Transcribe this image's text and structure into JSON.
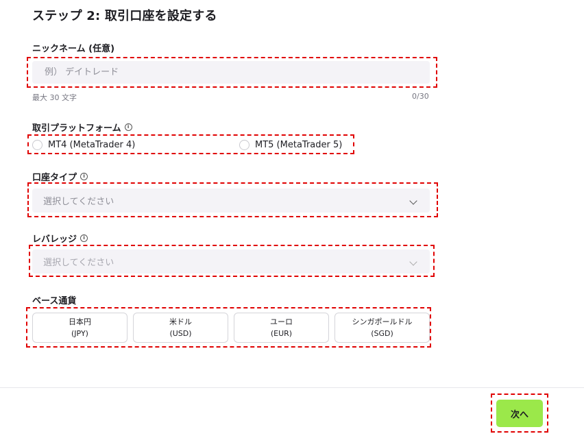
{
  "step_title": "ステップ 2: 取引口座を設定する",
  "nickname": {
    "label": "ニックネーム (任意)",
    "placeholder": "例） デイトレード",
    "value": "",
    "helper": "最大 30 文字",
    "counter": "0/30"
  },
  "platform": {
    "label": "取引プラットフォーム",
    "options": [
      {
        "label": "MT4 (MetaTrader 4)",
        "selected": false
      },
      {
        "label": "MT5 (MetaTrader 5)",
        "selected": false
      }
    ]
  },
  "account_type": {
    "label": "口座タイプ",
    "placeholder": "選択してください"
  },
  "leverage": {
    "label": "レバレッジ",
    "placeholder": "選択してください",
    "disabled": true
  },
  "base_currency": {
    "label": "ベース通貨",
    "options": [
      {
        "name": "日本円",
        "code": "(JPY)"
      },
      {
        "name": "米ドル",
        "code": "(USD)"
      },
      {
        "name": "ユーロ",
        "code": "(EUR)"
      },
      {
        "name": "シンガポールドル",
        "code": "(SGD)"
      }
    ]
  },
  "next_button": "次へ",
  "icons": {
    "info": "info-icon",
    "chevron": "chevron-down-icon"
  },
  "colors": {
    "accent_button": "#9be84a",
    "highlight_dash": "#e00000",
    "field_bg": "#f4f3f7"
  }
}
